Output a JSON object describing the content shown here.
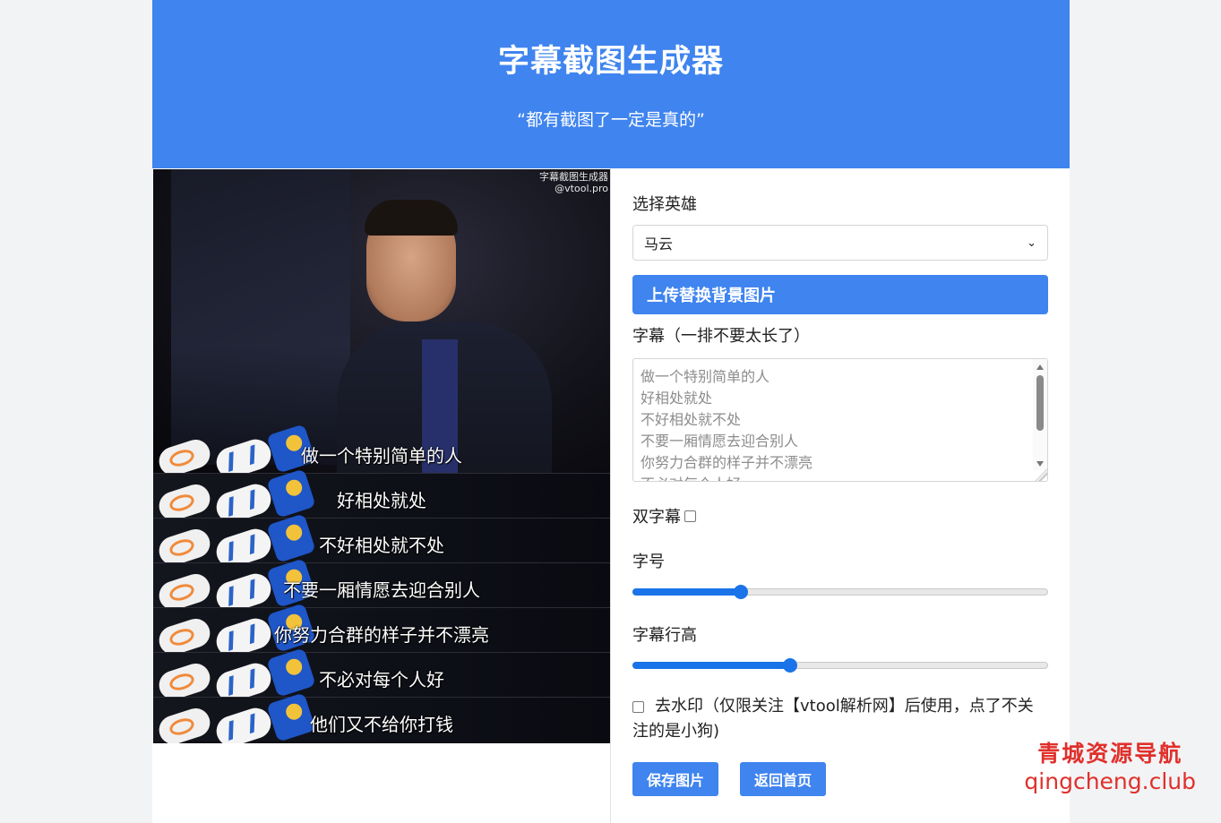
{
  "header": {
    "title": "字幕截图生成器",
    "subtitle": "“都有截图了一定是真的”"
  },
  "preview": {
    "watermark_line1": "字幕截图生成器",
    "watermark_line2": "@vtool.pro",
    "subtitles": [
      "做一个特别简单的人",
      "好相处就处",
      "不好相处就不处",
      "不要一厢情愿去迎合别人",
      "你努力合群的样子并不漂亮",
      "不必对每个人好",
      "他们又不给你打钱"
    ]
  },
  "form": {
    "hero_label": "选择英雄",
    "hero_selected": "马云",
    "upload_button": "上传替换背景图片",
    "subtitle_label": "字幕（一排不要太长了）",
    "subtitle_lines": [
      "做一个特别简单的人",
      "好相处就处",
      "不好相处就不处",
      "不要一厢情愿去迎合别人",
      "你努力合群的样子并不漂亮",
      "不必对每个人好"
    ],
    "double_subtitle_label": "双字幕",
    "font_size_label": "字号",
    "font_size_value": 0.26,
    "line_height_label": "字幕行高",
    "line_height_value": 0.38,
    "remove_watermark_label": "去水印（仅限关注【vtool解析网】后使用，点了不关注的是小狗)",
    "save_button": "保存图片",
    "home_button": "返回首页"
  },
  "site_mark": {
    "cn": "青城资源导航",
    "en": "qingcheng.club"
  },
  "colors": {
    "accent": "#3f84ef",
    "slider": "#1a73e8",
    "site_mark": "#e0302b"
  }
}
